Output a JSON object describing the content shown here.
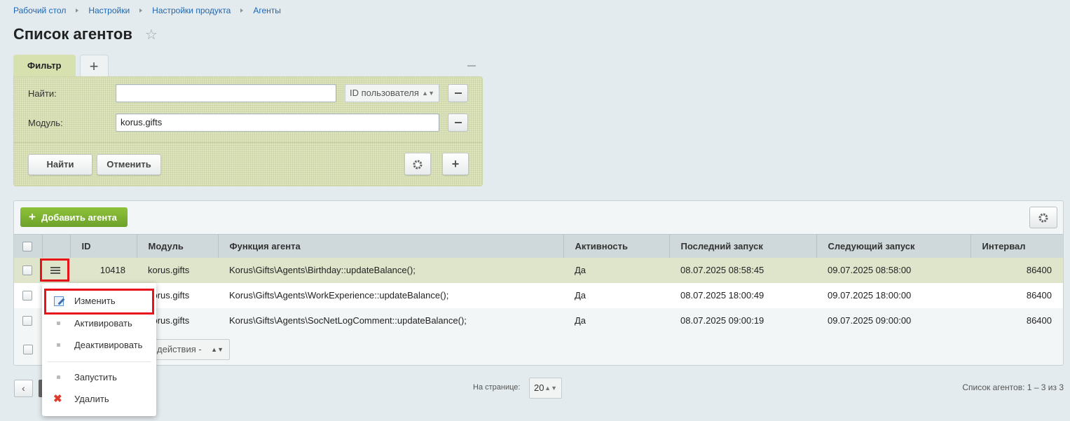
{
  "breadcrumb": [
    "Рабочий стол",
    "Настройки",
    "Настройки продукта",
    "Агенты"
  ],
  "page_title": "Список агентов",
  "filter": {
    "tab_label": "Фильтр",
    "find_label": "Найти:",
    "find_value": "",
    "find_select": "ID пользователя",
    "module_label": "Модуль:",
    "module_value": "korus.gifts",
    "find_button": "Найти",
    "cancel_button": "Отменить"
  },
  "grid": {
    "add_button": "Добавить агента",
    "columns": [
      "ID",
      "Модуль",
      "Функция агента",
      "Активность",
      "Последний запуск",
      "Следующий запуск",
      "Интервал"
    ],
    "rows": [
      {
        "id": "10418",
        "module": "korus.gifts",
        "func": "Korus\\Gifts\\Agents\\Birthday::updateBalance();",
        "active": "Да",
        "last": "08.07.2025 08:58:45",
        "next": "09.07.2025 08:58:00",
        "interval": "86400"
      },
      {
        "id": "",
        "module": "korus.gifts",
        "func": "Korus\\Gifts\\Agents\\WorkExperience::updateBalance();",
        "active": "Да",
        "last": "08.07.2025 18:00:49",
        "next": "09.07.2025 18:00:00",
        "interval": "86400"
      },
      {
        "id": "",
        "module": "korus.gifts",
        "func": "Korus\\Gifts\\Agents\\SocNetLogComment::updateBalance();",
        "active": "Да",
        "last": "08.07.2025 09:00:19",
        "next": "09.07.2025 09:00:00",
        "interval": "86400"
      }
    ],
    "actions_select": "действия -"
  },
  "context_menu": [
    "Изменить",
    "Активировать",
    "Деактивировать",
    "Запустить",
    "Удалить"
  ],
  "footer": {
    "per_page_label": "На странице:",
    "per_page_value": "20",
    "total": "Список агентов: 1 – 3 из 3"
  },
  "colors": {
    "accent": "#78ad2e",
    "highlight": "#e8121a",
    "filter_bg": "#dde4bf"
  }
}
